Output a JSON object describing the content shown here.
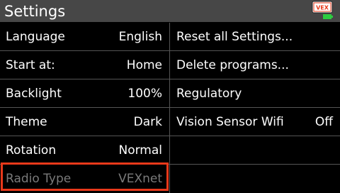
{
  "header": {
    "title": "Settings",
    "icon": "vex-brain-battery-icon",
    "brand_text": "VEX",
    "brand_color": "#e8391a",
    "battery_color": "#2ecc40"
  },
  "left_items": [
    {
      "label": "Language",
      "value": "English"
    },
    {
      "label": "Start at:",
      "value": "Home"
    },
    {
      "label": "Backlight",
      "value": "100%"
    },
    {
      "label": "Theme",
      "value": "Dark"
    },
    {
      "label": "Rotation",
      "value": "Normal"
    },
    {
      "label": "Radio Type",
      "value": "VEXnet",
      "state": "disabled",
      "selected": true
    }
  ],
  "right_items": [
    {
      "label": "Reset all Settings..."
    },
    {
      "label": "Delete programs..."
    },
    {
      "label": "Regulatory"
    },
    {
      "label": "Vision Sensor Wifi",
      "value": "Off"
    }
  ],
  "colors": {
    "title_bar": "#474747",
    "background": "#000000",
    "selection_outline": "#e8391a",
    "disabled_text": "#7a7a7a"
  }
}
